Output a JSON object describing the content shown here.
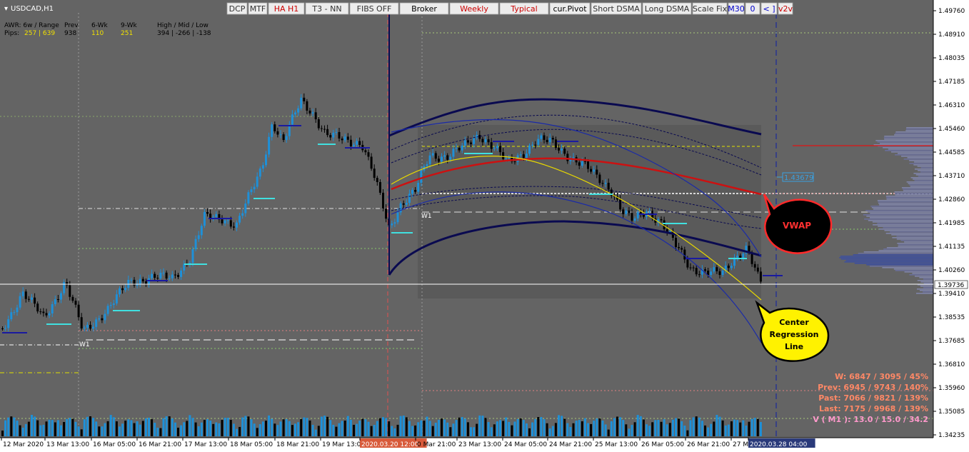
{
  "symbol": "USDCAD,H1",
  "toolbar": [
    {
      "label": "DCP",
      "color": "#333333"
    },
    {
      "label": "MTF",
      "color": "#333333"
    },
    {
      "label": "HA H1",
      "color": "#cc0000"
    },
    {
      "label": "T3 - NN",
      "color": "#333333"
    },
    {
      "label": "FIBS OFF",
      "color": "#333333"
    },
    {
      "label": "Broker",
      "color": "#000000"
    },
    {
      "label": "Weekly",
      "color": "#cc0000"
    },
    {
      "label": "Typical",
      "color": "#cc0000"
    },
    {
      "label": "cur.Pivot",
      "color": "#000000"
    },
    {
      "label": "Short DSMA",
      "color": "#333333"
    },
    {
      "label": "Long DSMA",
      "color": "#333333"
    },
    {
      "label": "Scale Fix",
      "color": "#333333"
    },
    {
      "label": "M30",
      "color": "#0000cc"
    },
    {
      "label": "0",
      "color": "#0000cc"
    },
    {
      "label": "< ]",
      "color": "#0000cc"
    },
    {
      "label": "v2v",
      "color": "#cc0000"
    }
  ],
  "awr": {
    "row1": {
      "c1": "AWR:  6w / Range",
      "c2": "Prev",
      "c3": "6-Wk",
      "c4": "9-Wk",
      "c5": "High / Mid / Low"
    },
    "row2": {
      "c1": "Pips:",
      "c1v": "257 | 639",
      "c2": "938",
      "c3": "110",
      "c4": "251",
      "c5": "394  |  -266  |  -138"
    }
  },
  "price_axis": {
    "labels": [
      "1.49760",
      "1.48910",
      "1.48035",
      "1.47185",
      "1.46310",
      "1.45460",
      "1.44585",
      "1.43710",
      "1.42860",
      "1.41985",
      "1.41135",
      "1.40260",
      "1.39410",
      "1.38535",
      "1.37685",
      "1.36810",
      "1.35960",
      "1.35085",
      "1.34235"
    ],
    "current_price": "1.39736"
  },
  "time_axis": {
    "labels": [
      "12 Mar 2020",
      "13 Mar 13:00",
      "16 Mar 05:00",
      "16 Mar 21:00",
      "17 Mar 13:00",
      "18 Mar 05:00",
      "18 Mar 21:00",
      "19 Mar 13:00",
      "2020.03.20 12:00",
      "0 Mar 21:00",
      "23 Mar 13:00",
      "24 Mar 05:00",
      "24 Mar 21:00",
      "25 Mar 13:00",
      "26 Mar 05:00",
      "26 Mar 21:00",
      "27 M",
      "2020.03.28 04:00"
    ]
  },
  "annotations": {
    "vwap": "VWAP",
    "regression": [
      "Center",
      "Regression",
      "Line"
    ],
    "w1_a": "W1",
    "w1_b": "W1",
    "price_tag": "1.43679"
  },
  "stats": [
    {
      "text": "W: 6847 / 3095 / 45%",
      "color": "#ff8866"
    },
    {
      "text": "Prev: 6945 / 9743 / 140%",
      "color": "#ff8866"
    },
    {
      "text": "Past: 7066 / 9821 / 139%",
      "color": "#ff8866"
    },
    {
      "text": "Last: 7175 / 9968 / 139%",
      "color": "#ff8866"
    },
    {
      "text": "V ( M1 ): 13.0 / 15.0 / 34.2",
      "color": "#ff99cc"
    }
  ],
  "colors": {
    "background": "#646464",
    "bull": "#1e90d8",
    "bear": "#000000",
    "vwap": "#cc1111",
    "bands": "#0a0a50",
    "regression": "#e8d800"
  },
  "chart_data": {
    "type": "candlestick",
    "symbol": "USDCAD",
    "timeframe": "H1",
    "ylim": [
      1.3423,
      1.4976
    ],
    "current_price": 1.39736,
    "vwap_label": "VWAP",
    "regression_label": "Center Regression Line",
    "close_series_approx": {
      "x": [
        "12 Mar 2020",
        "13 Mar 13:00",
        "16 Mar 05:00",
        "16 Mar 21:00",
        "17 Mar 13:00",
        "18 Mar 05:00",
        "18 Mar 21:00",
        "19 Mar 13:00",
        "2020.03.20 12:00",
        "0 Mar 21:00",
        "23 Mar 13:00",
        "24 Mar 05:00",
        "24 Mar 21:00",
        "25 Mar 13:00",
        "26 Mar 05:00",
        "26 Mar 21:00",
        "27 M"
      ],
      "values": [
        1.391,
        1.382,
        1.388,
        1.397,
        1.405,
        1.421,
        1.447,
        1.453,
        1.412,
        1.45,
        1.452,
        1.446,
        1.448,
        1.433,
        1.419,
        1.406,
        1.397
      ]
    }
  }
}
